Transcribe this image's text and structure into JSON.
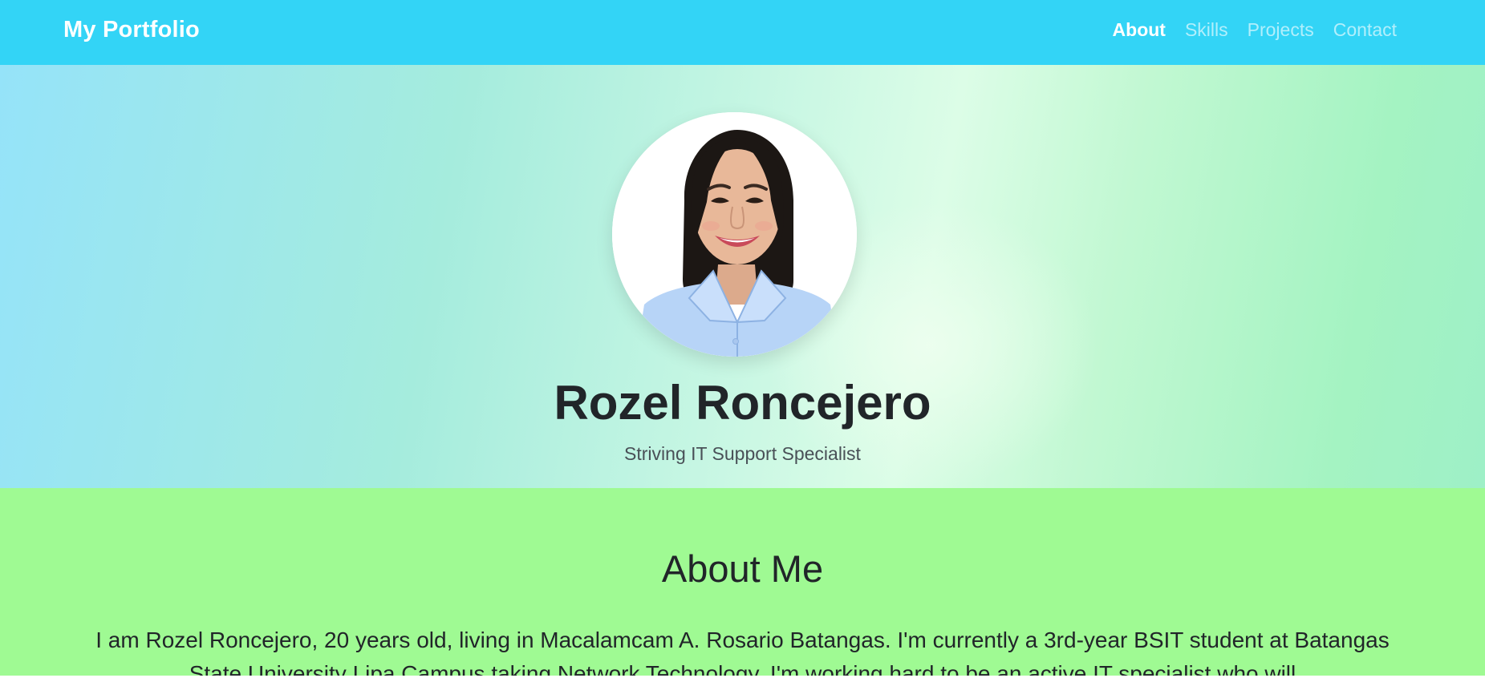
{
  "navbar": {
    "brand": "My Portfolio",
    "links": [
      {
        "label": "About",
        "active": true
      },
      {
        "label": "Skills",
        "active": false
      },
      {
        "label": "Projects",
        "active": false
      },
      {
        "label": "Contact",
        "active": false
      }
    ]
  },
  "hero": {
    "name": "Rozel Roncejero",
    "tagline": "Striving IT Support Specialist"
  },
  "about": {
    "title": "About Me",
    "text": "I am Rozel Roncejero, 20 years old, living in Macalamcam A. Rosario Batangas. I'm currently a 3rd-year BSIT student at Batangas State University Lipa Campus taking Network Technology. I'm working hard to be an active IT specialist who will"
  },
  "colors": {
    "navbar": "#33d4f6",
    "about_background": "#9ffa93",
    "text": "#212529"
  }
}
